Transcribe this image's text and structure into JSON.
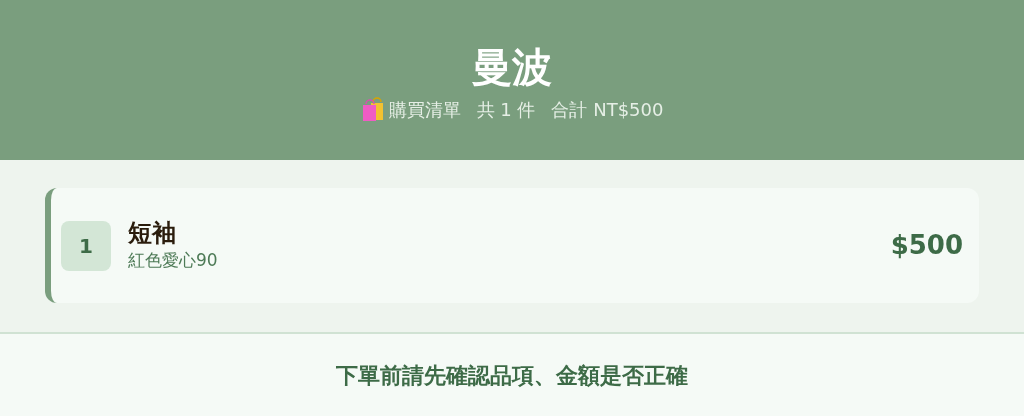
{
  "header": {
    "title": "曼波",
    "list_label": "購買清單",
    "count": "共 1 件",
    "total": "合計 NT$500"
  },
  "items": [
    {
      "index": "1",
      "name": "短袖",
      "variant": "紅色愛心90",
      "price": "$500"
    }
  ],
  "footer": {
    "notice": "下單前請先確認品項、金額是否正確"
  }
}
